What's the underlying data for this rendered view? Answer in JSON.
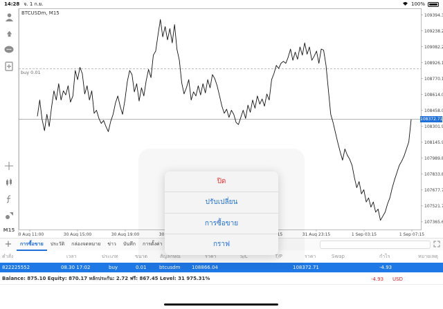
{
  "status_bar": {
    "time": "14:28",
    "date": "จ. 1 ก.ย.",
    "battery": "100%"
  },
  "toolbar": {
    "timeframe": "M15",
    "icons": [
      "account-icon",
      "trade-icon",
      "chat-icon",
      "new-order-icon",
      "crosshair-icon",
      "indicators-icon",
      "function-icon",
      "objects-icon"
    ]
  },
  "chart": {
    "symbol_label": "BTCUSDm, M15",
    "buy_line_label": "buy 0.01",
    "current_price_tag": "108372.71",
    "colors": {
      "line": "#111111",
      "current_price": "#1e6fd9",
      "buy_line": "#aaaaaa"
    }
  },
  "chart_data": {
    "type": "line",
    "title": "BTCUSDm, M15",
    "y_ticks": [
      "109394.30",
      "109238.25",
      "109082.20",
      "108926.15",
      "108770.10",
      "108614.05",
      "108458.00",
      "108301.95",
      "108145.90",
      "107989.85",
      "107833.80",
      "107677.75",
      "107521.70",
      "107365.65"
    ],
    "x_ticks": [
      "30 Aug 11:00",
      "30 Aug 15:00",
      "30 Aug 19:00",
      "30 Aug 23:00",
      "31 Aug 15:15",
      "31 Aug 19:15",
      "31 Aug 23:15",
      "1 Sep 03:15",
      "1 Sep 07:15"
    ],
    "ylim": [
      107290,
      109460
    ],
    "buy_level": 108866.04,
    "current_price": 108372.71,
    "series": [
      {
        "values": [
          108400,
          108560,
          108370,
          108260,
          108420,
          108300,
          108490,
          108650,
          108560,
          108720,
          108560,
          108650,
          108610,
          108700,
          108540,
          108600,
          108850,
          108760,
          108880,
          108820,
          108620,
          108700,
          108560,
          108650,
          108430,
          108460,
          108380,
          108330,
          108360,
          108300,
          108250,
          108350,
          108420,
          108530,
          108600,
          108500,
          108420,
          108560,
          108740,
          108850,
          108810,
          108640,
          108720,
          108550,
          108680,
          108600,
          108750,
          108860,
          108780,
          109000,
          109040,
          109200,
          109350,
          109180,
          109280,
          109150,
          109260,
          109120,
          109300,
          109060,
          108950,
          108730,
          108620,
          108680,
          108760,
          108560,
          108640,
          108600,
          108700,
          108610,
          108720,
          108630,
          108760,
          108680,
          108810,
          108770,
          108700,
          108600,
          108500,
          108430,
          108470,
          108390,
          108460,
          108420,
          108340,
          108320,
          108390,
          108460,
          108380,
          108510,
          108440,
          108560,
          108480,
          108600,
          108520,
          108570,
          108500,
          108620,
          108560,
          108760,
          108820,
          108900,
          108870,
          108920,
          108940,
          108920,
          108980,
          109060,
          108950,
          109030,
          108960,
          109080,
          109000,
          109120,
          109010,
          109080,
          108950,
          108990,
          109040,
          108920,
          109060,
          109050,
          108900,
          108660,
          108420,
          108340,
          108240,
          108140,
          108050,
          107970,
          108080,
          108020,
          107980,
          107920,
          107800,
          107700,
          107760,
          107640,
          107680,
          107560,
          107600,
          107510,
          107560,
          107460,
          107490,
          107380,
          107420,
          107460,
          107540,
          107600,
          107700,
          107780,
          107850,
          107920,
          107960,
          108010,
          108080,
          108150,
          108370
        ]
      }
    ]
  },
  "bottom_tabs": {
    "items": [
      "การซื้อขาย",
      "ประวัติ",
      "กล่องจดหมาย",
      "ข่าว",
      "บันทึก",
      "การตั้งค่า"
    ]
  },
  "table": {
    "headers": {
      "order": "คำสั่ง",
      "time": "เวลา",
      "type": "ประเภท",
      "volume": "ขนาด",
      "symbol": "สัญลักษณ์",
      "price": "ราคา",
      "sl": "S/L",
      "tp": "T/P",
      "current": "ราคา",
      "swap": "Swap",
      "profit": "กำไร",
      "comment": "หมายเหตุ"
    },
    "rows": [
      {
        "order": "822225552",
        "time": "08.30 17:02",
        "type": "buy",
        "volume": "0.01",
        "symbol": "btcusdm",
        "price": "108866.04",
        "current": "108372.71",
        "profit": "-4.93"
      }
    ]
  },
  "balance": {
    "text": "Balance: 875.10 Equity: 870.17 หลักประกัน: 2.72 ฟรี: 867.45 Level: 31 975.31%",
    "profit": "-4.93",
    "currency": "USD"
  },
  "popup_menu": {
    "items": [
      "ปิด",
      "ปรับเปลี่ยน",
      "การซื้อขาย",
      "กราฟ"
    ]
  }
}
